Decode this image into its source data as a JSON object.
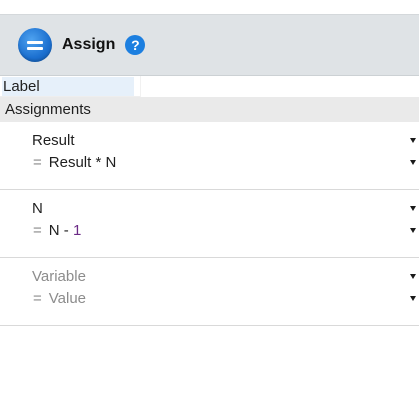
{
  "header": {
    "title": "Assign",
    "icon": "assign-equals-icon",
    "help_icon": "help-question-icon",
    "help_glyph": "?",
    "accent": "#1c7fe0"
  },
  "label_field": {
    "label": "Label",
    "value": ""
  },
  "assignments_section": {
    "title": "Assignments",
    "rows": [
      {
        "target": "Result",
        "eq": "=",
        "expression_text": "Result * N",
        "expression_number": ""
      },
      {
        "target": "N",
        "eq": "=",
        "expression_text": "N - ",
        "expression_number": "1"
      },
      {
        "target": "Variable",
        "eq": "=",
        "expression_text": "Value",
        "expression_number": ""
      }
    ]
  }
}
